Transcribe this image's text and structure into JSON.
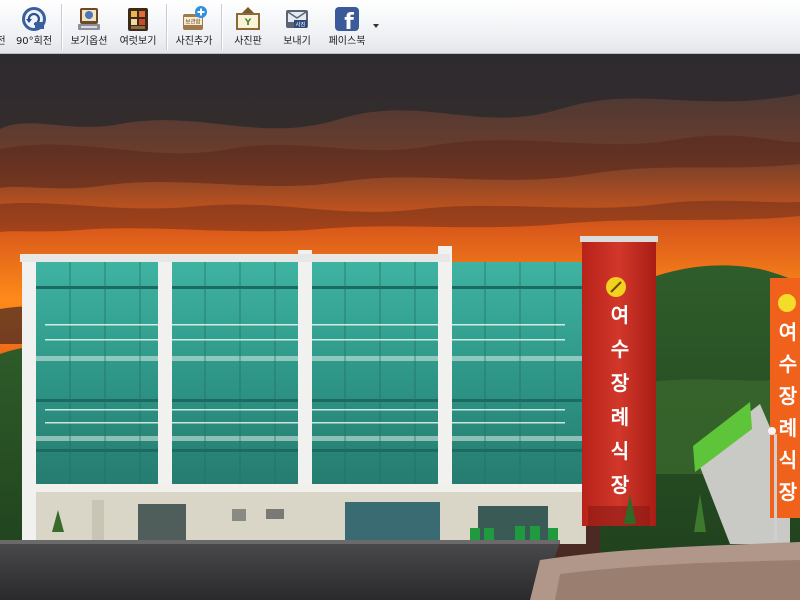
{
  "toolbar": {
    "buttons": [
      {
        "id": "partial-left",
        "label": "전"
      },
      {
        "id": "rotate-90",
        "label": "90°회전",
        "icon": "rotate-icon"
      },
      {
        "id": "view-options",
        "label": "보기옵션",
        "icon": "view-options-icon"
      },
      {
        "id": "multi-view",
        "label": "여럿보기",
        "icon": "multi-view-icon"
      },
      {
        "id": "add-photo",
        "label": "사진추가",
        "icon": "add-photo-icon",
        "icon_text": "보관함"
      },
      {
        "id": "photo-board",
        "label": "사진판",
        "icon": "photo-board-icon",
        "icon_text": "Y"
      },
      {
        "id": "send",
        "label": "보내기",
        "icon": "send-icon",
        "icon_text": "사진"
      },
      {
        "id": "facebook",
        "label": "페이스북",
        "icon": "facebook-icon",
        "icon_text": "f"
      }
    ],
    "more_icon": "dropdown-arrow-icon"
  },
  "photo": {
    "subject": "wedding-hall-building",
    "main_sign": [
      "여",
      "수",
      "장",
      "례",
      "식",
      "장"
    ],
    "side_sign": [
      "여",
      "수",
      "장",
      "례",
      "식",
      "장"
    ],
    "colors": {
      "sky_top": "#3d3a3f",
      "sky_glow": "#ff7a12",
      "glass": "#2f9a8c",
      "sign_red": "#c52a1f",
      "side_sign": "#f0611c"
    }
  }
}
